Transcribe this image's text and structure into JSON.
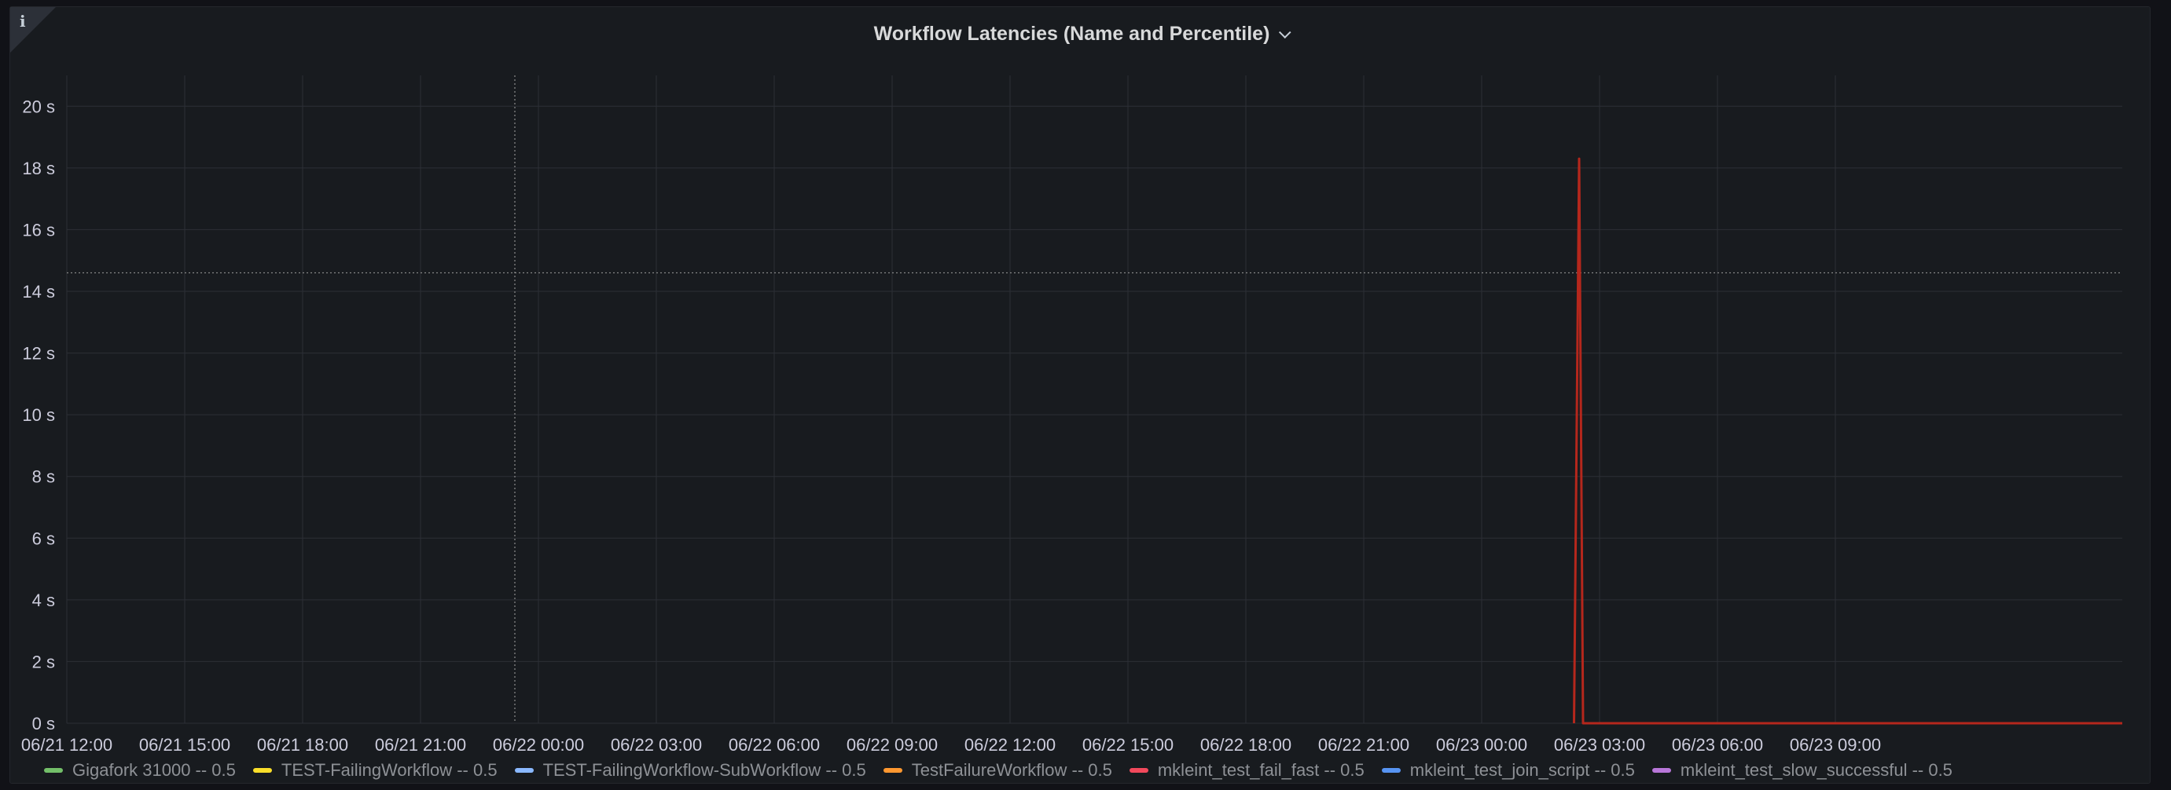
{
  "panel": {
    "title": "Workflow Latencies (Name and Percentile)",
    "info_icon_glyph": "i"
  },
  "colors": {
    "background": "#181b1f",
    "grid": "#2c2f36",
    "threshold": "#8e8e8e",
    "spike": "#b5271c"
  },
  "chart_data": {
    "type": "line",
    "title": "Workflow Latencies (Name and Percentile)",
    "xlabel": "",
    "ylabel": "",
    "ylim": [
      0,
      21
    ],
    "y_ticks": [
      {
        "value": 0,
        "label": "0 s"
      },
      {
        "value": 2,
        "label": "2 s"
      },
      {
        "value": 4,
        "label": "4 s"
      },
      {
        "value": 6,
        "label": "6 s"
      },
      {
        "value": 8,
        "label": "8 s"
      },
      {
        "value": 10,
        "label": "10 s"
      },
      {
        "value": 12,
        "label": "12 s"
      },
      {
        "value": 14,
        "label": "14 s"
      },
      {
        "value": 16,
        "label": "16 s"
      },
      {
        "value": 18,
        "label": "18 s"
      },
      {
        "value": 20,
        "label": "20 s"
      }
    ],
    "x_range_hours": [
      0,
      52.3
    ],
    "x_ticks": [
      {
        "value": 0,
        "label": "06/21 12:00"
      },
      {
        "value": 3,
        "label": "06/21 15:00"
      },
      {
        "value": 6,
        "label": "06/21 18:00"
      },
      {
        "value": 9,
        "label": "06/21 21:00"
      },
      {
        "value": 12,
        "label": "06/22 00:00"
      },
      {
        "value": 15,
        "label": "06/22 03:00"
      },
      {
        "value": 18,
        "label": "06/22 06:00"
      },
      {
        "value": 21,
        "label": "06/22 09:00"
      },
      {
        "value": 24,
        "label": "06/22 12:00"
      },
      {
        "value": 27,
        "label": "06/22 15:00"
      },
      {
        "value": 30,
        "label": "06/22 18:00"
      },
      {
        "value": 33,
        "label": "06/22 21:00"
      },
      {
        "value": 36,
        "label": "06/23 00:00"
      },
      {
        "value": 39,
        "label": "06/23 03:00"
      },
      {
        "value": 42,
        "label": "06/23 06:00"
      },
      {
        "value": 45,
        "label": "06/23 09:00"
      }
    ],
    "crosshair": {
      "x": 11.4,
      "y": 14.6
    },
    "series": [
      {
        "name": "Gigafork 31000 -- 0.5",
        "color": "#73bf69",
        "points": []
      },
      {
        "name": "TEST-FailingWorkflow -- 0.5",
        "color": "#fade2a",
        "points": []
      },
      {
        "name": "TEST-FailingWorkflow-SubWorkflow -- 0.5",
        "color": "#8ab8ff",
        "points": []
      },
      {
        "name": "TestFailureWorkflow -- 0.5",
        "color": "#ff9830",
        "points": []
      },
      {
        "name": "mkleint_test_fail_fast -- 0.5",
        "color": "#f2495c",
        "points": [
          [
            38.35,
            0
          ],
          [
            38.48,
            18.3
          ],
          [
            38.58,
            0
          ],
          [
            52.3,
            0
          ]
        ]
      },
      {
        "name": "mkleint_test_join_script -- 0.5",
        "color": "#5794f2",
        "points": []
      },
      {
        "name": "mkleint_test_slow_successful -- 0.5",
        "color": "#b877d9",
        "points": []
      }
    ]
  }
}
